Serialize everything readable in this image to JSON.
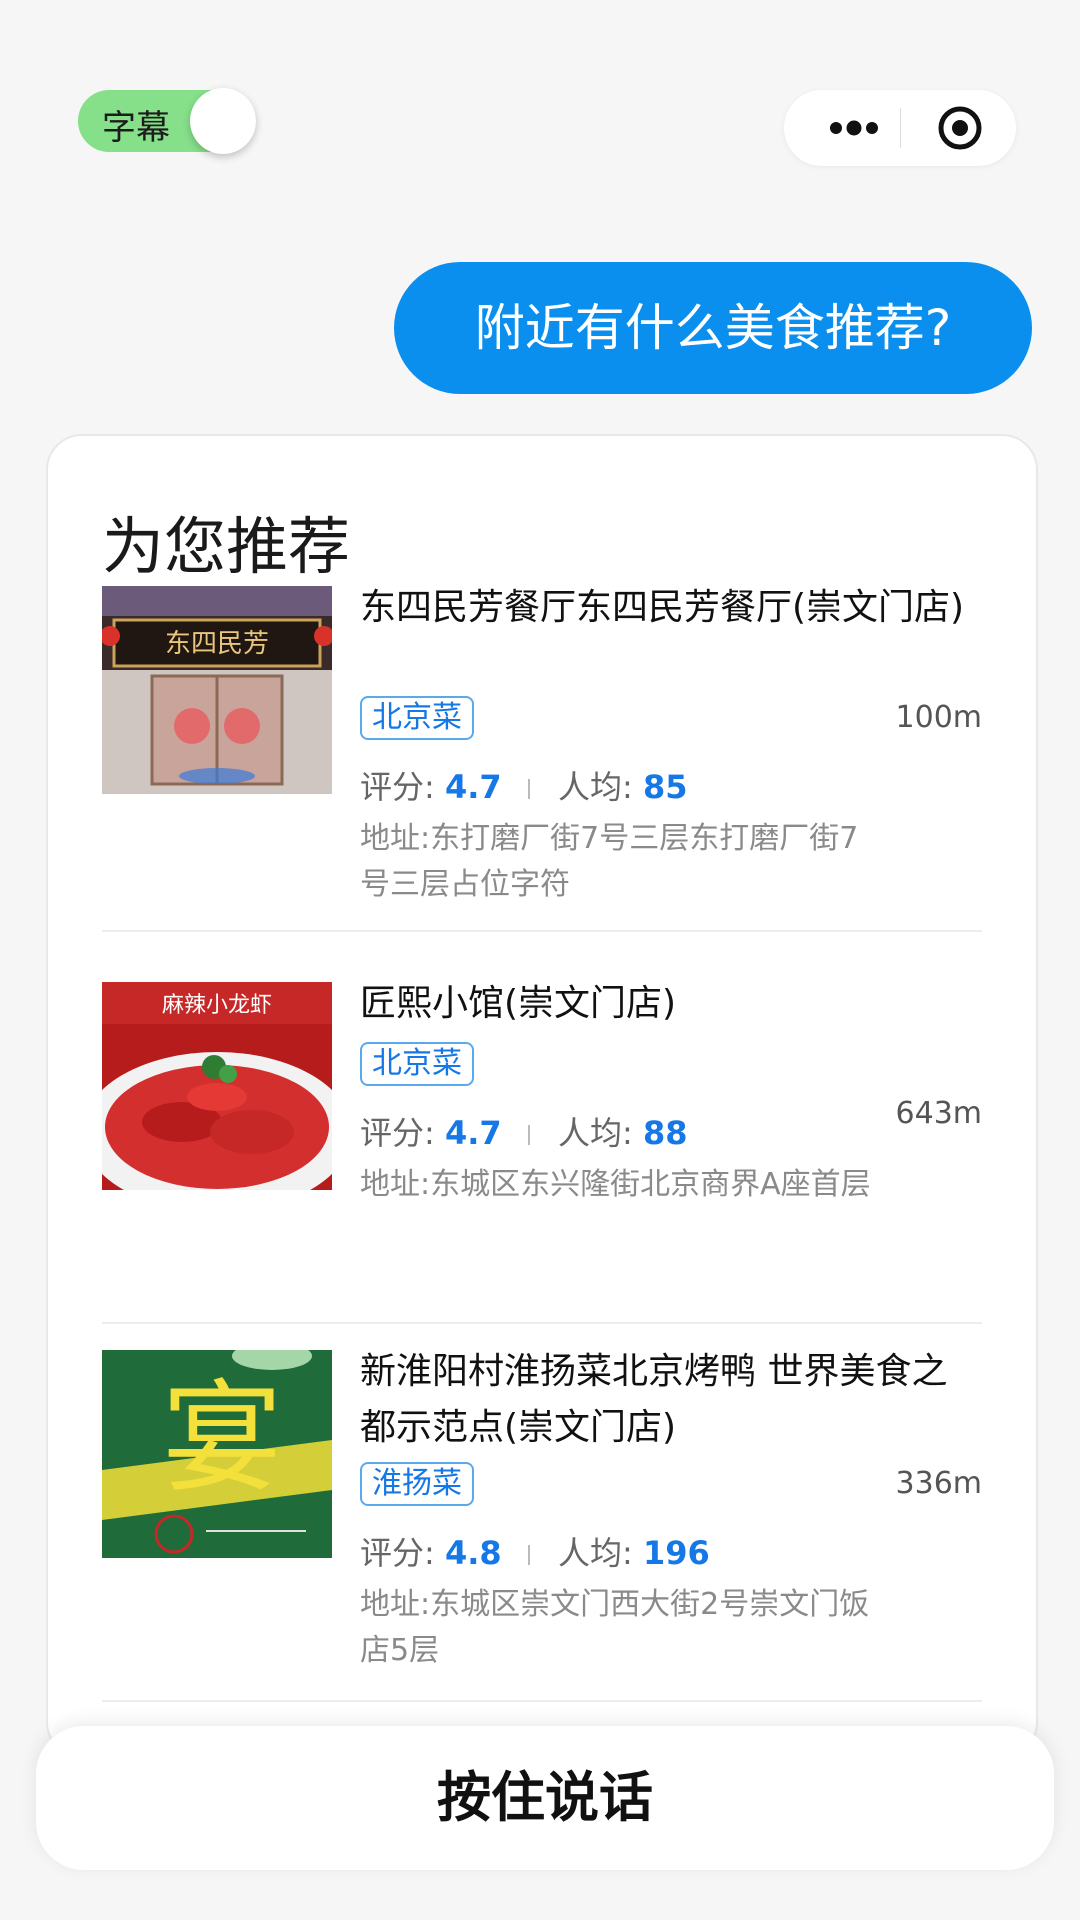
{
  "topbar": {
    "subtitle_toggle": {
      "label": "字幕",
      "on": true,
      "color": "#86e08a"
    },
    "capsule": {
      "more_icon": "more-dots-icon",
      "close_icon": "target-circle-icon"
    }
  },
  "chat": {
    "user_message": "附近有什么美食推荐?",
    "bubble_color": "#0a8fef"
  },
  "recommend": {
    "title": "为您推荐",
    "rating_label": "评分:",
    "avg_label": "人均:",
    "address_label": "地址:",
    "items": [
      {
        "name": "东四民芳餐厅东四民芳餐厅(崇文门店)",
        "cuisine": "北京菜",
        "distance": "100m",
        "rating": "4.7",
        "avg_price": "85",
        "address": "东打磨厂街7号三层东打磨厂街7号三层占位字符",
        "image_text": "东四民芳"
      },
      {
        "name": "匠熙小馆(崇文门店)",
        "cuisine": "北京菜",
        "distance": "643m",
        "rating": "4.7",
        "avg_price": "88",
        "address": "东城区东兴隆街北京商界A座首层",
        "image_text": "麻辣小龙虾"
      },
      {
        "name": "新淮阳村淮扬菜北京烤鸭 世界美食之都示范点(崇文门店)",
        "cuisine": "淮扬菜",
        "distance": "336m",
        "rating": "4.8",
        "avg_price": "196",
        "address": "东城区崇文门西大街2号崇文门饭店5层",
        "image_text": "宴"
      }
    ]
  },
  "bottom": {
    "talk_button": "按住说话"
  },
  "colors": {
    "accent": "#1677e6",
    "background": "#f6f6f7"
  }
}
